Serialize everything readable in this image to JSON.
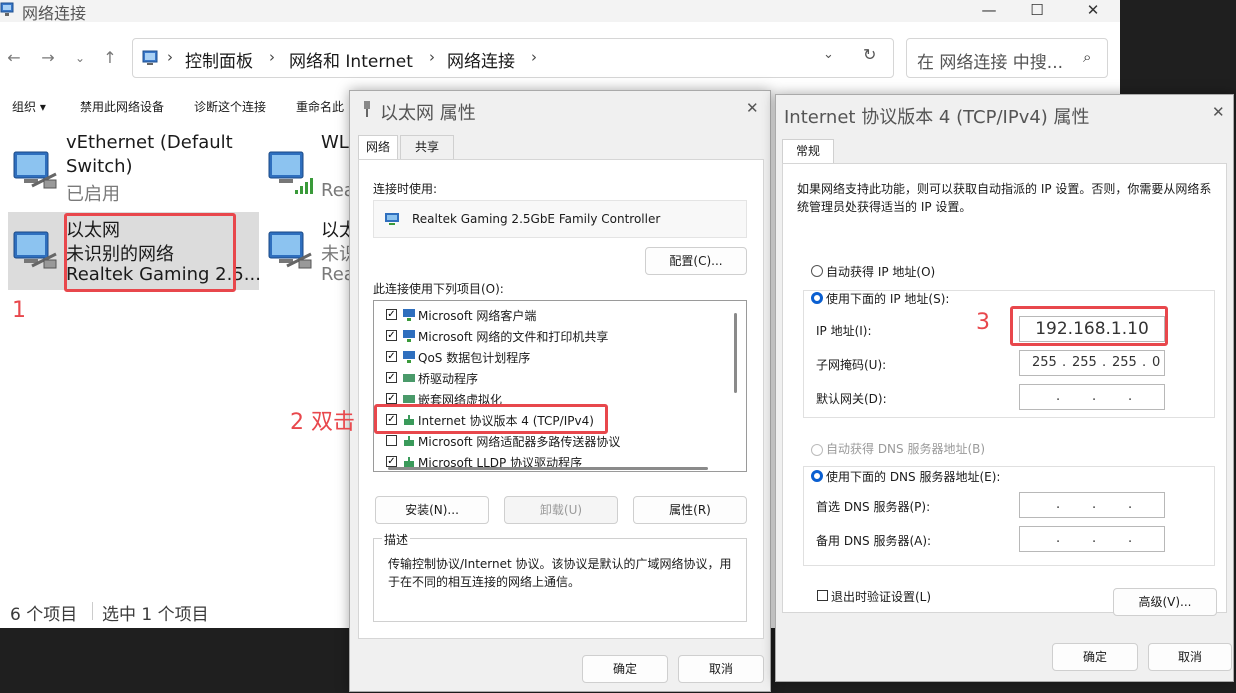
{
  "explorer": {
    "title": "网络连接",
    "breadcrumb": [
      "控制面板",
      "网络和 Internet",
      "网络连接"
    ],
    "search_placeholder": "在 网络连接 中搜...",
    "commands": [
      "组织 ▾",
      "禁用此网络设备",
      "诊断这个连接",
      "重命名此"
    ],
    "items": [
      {
        "l1": "vEthernet (Default",
        "l2": "Switch)",
        "l3": "已启用"
      },
      {
        "l1": "WL",
        "l2": "",
        "l3": "Rea"
      },
      {
        "l1": "以太网",
        "l2": "未识别的网络",
        "l3": "Realtek Gaming 2.5..."
      },
      {
        "l1": "以太",
        "l2": "未识",
        "l3": "Rea"
      }
    ],
    "status_count": "6 个项目",
    "status_selected": "选中 1 个项目"
  },
  "eth_props": {
    "title": "以太网 属性",
    "tabs": [
      "网络",
      "共享"
    ],
    "connect_using_label": "连接时使用:",
    "adapter": "Realtek Gaming 2.5GbE Family Controller",
    "configure_btn": "配置(C)...",
    "items_label": "此连接使用下列项目(O):",
    "items": [
      {
        "text": "Microsoft 网络客户端",
        "checked": true
      },
      {
        "text": "Microsoft 网络的文件和打印机共享",
        "checked": true
      },
      {
        "text": "QoS 数据包计划程序",
        "checked": true
      },
      {
        "text": "桥驱动程序",
        "checked": true
      },
      {
        "text": "嵌套网络虚拟化",
        "checked": true
      },
      {
        "text": "Internet 协议版本 4 (TCP/IPv4)",
        "checked": true
      },
      {
        "text": "Microsoft 网络适配器多路传送器协议",
        "checked": false
      },
      {
        "text": "Microsoft LLDP 协议驱动程序",
        "checked": true
      }
    ],
    "install_btn": "安装(N)...",
    "uninstall_btn": "卸载(U)",
    "properties_btn": "属性(R)",
    "desc_label": "描述",
    "description": "传输控制协议/Internet 协议。该协议是默认的广域网络协议，用于在不同的相互连接的网络上通信。",
    "ok_btn": "确定",
    "cancel_btn": "取消"
  },
  "ipv4": {
    "title": "Internet 协议版本 4 (TCP/IPv4) 属性",
    "tab": "常规",
    "intro": "如果网络支持此功能，则可以获取自动指派的 IP 设置。否则，你需要从网络系统管理员处获得适当的 IP 设置。",
    "auto_ip": "自动获得 IP 地址(O)",
    "manual_ip": "使用下面的 IP 地址(S):",
    "ip_label": "IP 地址(I):",
    "ip_value": "192.168.1.10",
    "mask_label": "子网掩码(U):",
    "mask_octets": [
      "255",
      "255",
      "255",
      "0"
    ],
    "gateway_label": "默认网关(D):",
    "auto_dns": "自动获得 DNS 服务器地址(B)",
    "manual_dns": "使用下面的 DNS 服务器地址(E):",
    "pref_dns_label": "首选 DNS 服务器(P):",
    "alt_dns_label": "备用 DNS 服务器(A):",
    "validate_label": "退出时验证设置(L)",
    "advanced_btn": "高级(V)...",
    "ok_btn": "确定",
    "cancel_btn": "取消"
  },
  "annotations": {
    "step1": "1",
    "step2": "2 双击",
    "step3": "3"
  },
  "colors": {
    "annotation_red": "#e8474c",
    "radio_blue": "#0a5fd1"
  }
}
